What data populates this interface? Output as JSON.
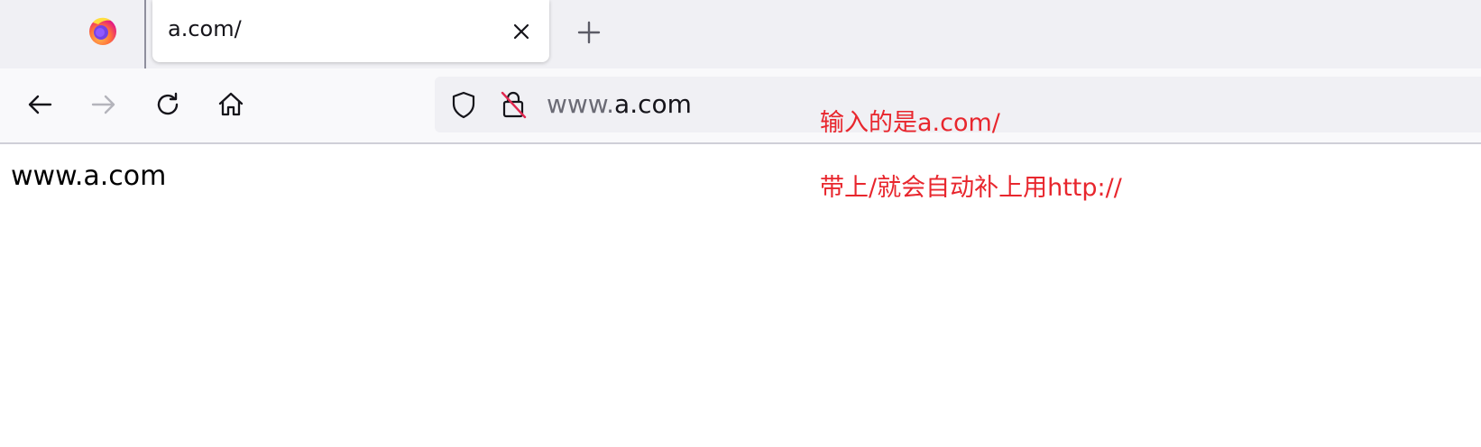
{
  "tab": {
    "title": "a.com/",
    "close_icon": "close-icon"
  },
  "toolbar": {
    "back_icon": "back-arrow-icon",
    "forward_icon": "forward-arrow-icon",
    "reload_icon": "reload-icon",
    "home_icon": "home-icon",
    "newtab_icon": "plus-icon"
  },
  "urlbar": {
    "shield_icon": "shield-icon",
    "insecure_lock_icon": "insecure-lock-icon",
    "url_prefix": "www.",
    "url_host": "a.com"
  },
  "page": {
    "text": "www.a.com"
  },
  "annotations": {
    "line1": "输入的是a.com/",
    "line2": "带上/就会自动补上用http://"
  },
  "colors": {
    "annotation": "#e8262d",
    "firefox_orange": "#ff7139",
    "firefox_purple": "#7542e5"
  }
}
